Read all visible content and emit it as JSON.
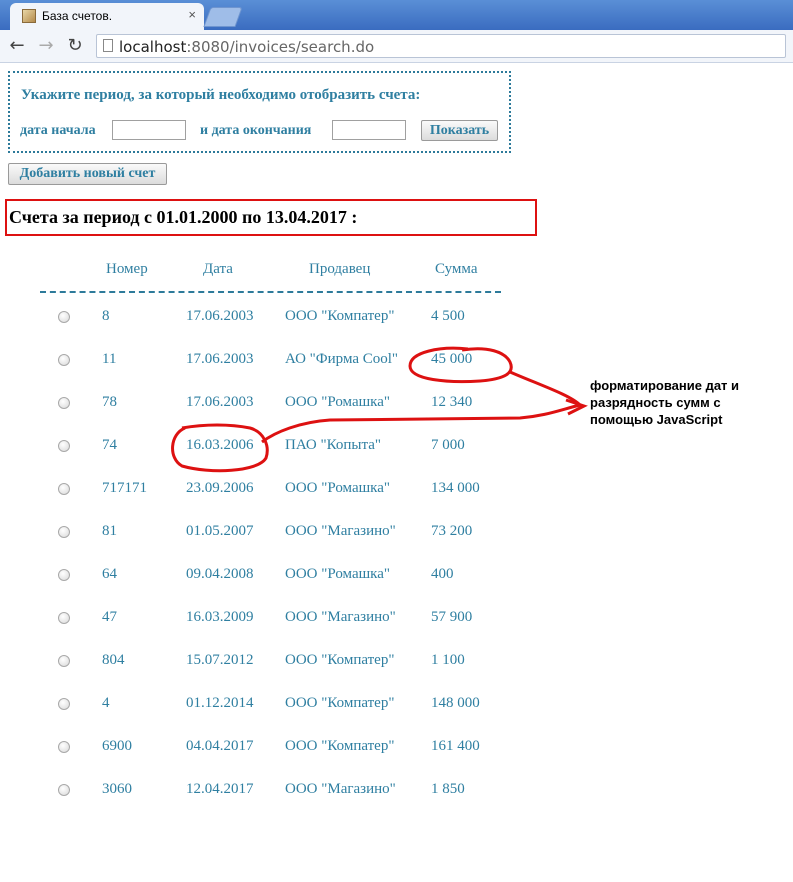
{
  "browser": {
    "tab_title": "База счетов.",
    "tab_close": "×",
    "url_host": "localhost",
    "url_rest": ":8080/invoices/search.do"
  },
  "form": {
    "heading": "Укажите период, за который необходимо отобразить счета:",
    "start_label": "дата начала",
    "end_label": "и дата окончания",
    "start_value": "",
    "end_value": "",
    "show_button": "Показать"
  },
  "add_button": "Добавить новый счет",
  "result_title": "Счета за период с 01.01.2000 по 13.04.2017 :",
  "table": {
    "headers": {
      "number": "Номер",
      "date": "Дата",
      "seller": "Продавец",
      "sum": "Сумма"
    },
    "rows": [
      {
        "number": "8",
        "date": "17.06.2003",
        "seller": "ООО \"Компатер\"",
        "sum": "4 500"
      },
      {
        "number": "11",
        "date": "17.06.2003",
        "seller": "АО \"Фирма Cool\"",
        "sum": "45 000"
      },
      {
        "number": "78",
        "date": "17.06.2003",
        "seller": "ООО \"Ромашка\"",
        "sum": "12 340"
      },
      {
        "number": "74",
        "date": "16.03.2006",
        "seller": "ПАО \"Копыта\"",
        "sum": "7 000"
      },
      {
        "number": "717171",
        "date": "23.09.2006",
        "seller": "ООО \"Ромашка\"",
        "sum": "134 000"
      },
      {
        "number": "81",
        "date": "01.05.2007",
        "seller": "ООО \"Магазино\"",
        "sum": "73 200"
      },
      {
        "number": "64",
        "date": "09.04.2008",
        "seller": "ООО \"Ромашка\"",
        "sum": "400"
      },
      {
        "number": "47",
        "date": "16.03.2009",
        "seller": "ООО \"Магазино\"",
        "sum": "57 900"
      },
      {
        "number": "804",
        "date": "15.07.2012",
        "seller": "ООО \"Компатер\"",
        "sum": "1 100"
      },
      {
        "number": "4",
        "date": "01.12.2014",
        "seller": "ООО \"Компатер\"",
        "sum": "148 000"
      },
      {
        "number": "6900",
        "date": "04.04.2017",
        "seller": "ООО \"Компатер\"",
        "sum": "161 400"
      },
      {
        "number": "3060",
        "date": "12.04.2017",
        "seller": "ООО \"Магазино\"",
        "sum": "1 850"
      }
    ]
  },
  "annotation": {
    "line1": "форматирование дат и",
    "line2": "разрядность сумм с",
    "line3": "помощью JavaScript"
  },
  "colors": {
    "link_text": "#2f7fa1",
    "annotation_red": "#dd1111",
    "result_border": "#d11111"
  }
}
